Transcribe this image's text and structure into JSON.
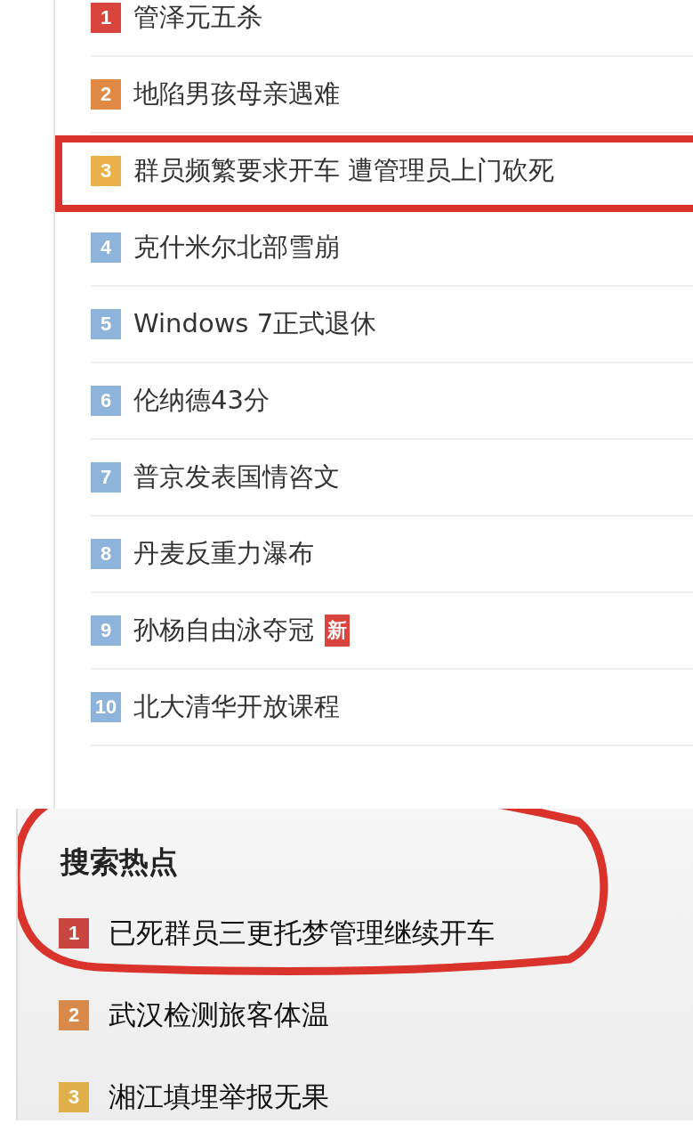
{
  "hot_list": {
    "items": [
      {
        "rank": "1",
        "title": "管泽元五杀",
        "color": "#d9453c",
        "highlighted": false
      },
      {
        "rank": "2",
        "title": "地陷男孩母亲遇难",
        "color": "#e08a45",
        "highlighted": false
      },
      {
        "rank": "3",
        "title": "群员频繁要求开车 遭管理员上门砍死",
        "color": "#eab04a",
        "highlighted": true
      },
      {
        "rank": "4",
        "title": "克什米尔北部雪崩",
        "color": "#8fb4dc",
        "highlighted": false
      },
      {
        "rank": "5",
        "title": "Windows 7正式退休",
        "color": "#8fb4dc",
        "highlighted": false
      },
      {
        "rank": "6",
        "title": "伦纳德43分",
        "color": "#8fb4dc",
        "highlighted": false
      },
      {
        "rank": "7",
        "title": "普京发表国情咨文",
        "color": "#8fb4dc",
        "highlighted": false
      },
      {
        "rank": "8",
        "title": "丹麦反重力瀑布",
        "color": "#8fb4dc",
        "highlighted": false
      },
      {
        "rank": "9",
        "title": "孙杨自由泳夺冠",
        "color": "#8fb4dc",
        "highlighted": false,
        "badge": "新"
      },
      {
        "rank": "10",
        "title": "北大清华开放课程",
        "color": "#8fb4dc",
        "highlighted": false
      }
    ]
  },
  "search_hot": {
    "title": "搜索热点",
    "items": [
      {
        "rank": "1",
        "title": "已死群员三更托梦管理继续开车",
        "color": "#c9453f",
        "highlighted": true
      },
      {
        "rank": "2",
        "title": "武汉检测旅客体温",
        "color": "#d98a4a",
        "highlighted": false
      },
      {
        "rank": "3",
        "title": "湘江填埋举报无果",
        "color": "#e0b04a",
        "highlighted": false
      }
    ]
  }
}
